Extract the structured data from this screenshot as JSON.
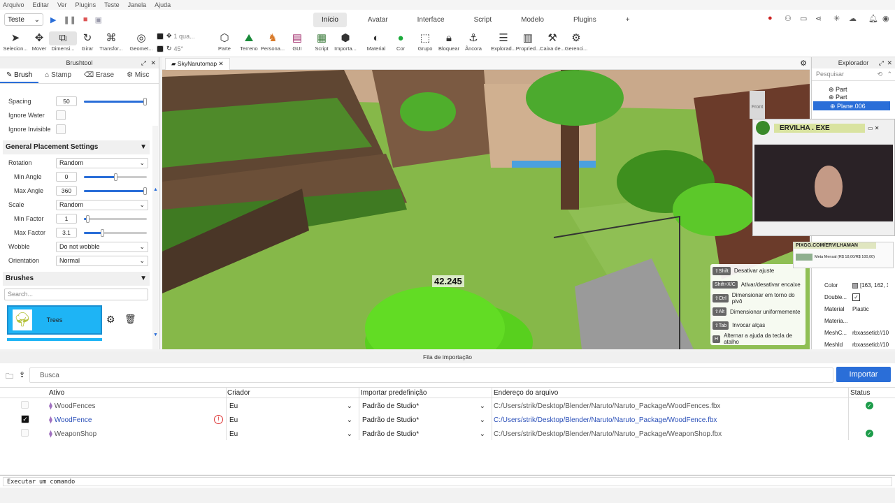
{
  "menu": [
    "Arquivo",
    "Editar",
    "Ver",
    "Plugins",
    "Teste",
    "Janela",
    "Ajuda"
  ],
  "place_select": "Teste",
  "ribbon_tabs": [
    "Início",
    "Avatar",
    "Interface",
    "Script",
    "Modelo",
    "Plugins"
  ],
  "tools": [
    "Selecion...",
    "Mover",
    "Dimensi...",
    "Girar",
    "Transfor...",
    "Geomet...",
    "Parte",
    "Terreno",
    "Persona...",
    "GUI",
    "Script",
    "Importa...",
    "Material",
    "Cor",
    "Grupo",
    "Bloquear",
    "Âncora",
    "Explorad...",
    "Propried...",
    "Caixa de...",
    "Gerenci..."
  ],
  "snap": {
    "move": "1 qua...",
    "rotate": "45°"
  },
  "brushtool": {
    "title": "Brushtool",
    "tabs": [
      "Brush",
      "Stamp",
      "Erase",
      "Misc"
    ],
    "spacing_label": "Spacing",
    "spacing_value": "50",
    "ignore_water": "Ignore Water",
    "ignore_invisible": "Ignore Invisible",
    "section_general": "General Placement Settings",
    "rotation_label": "Rotation",
    "rotation_value": "Random",
    "min_angle_label": "Min Angle",
    "min_angle_value": "0",
    "max_angle_label": "Max Angle",
    "max_angle_value": "360",
    "scale_label": "Scale",
    "scale_value": "Random",
    "min_factor_label": "Min Factor",
    "min_factor_value": "1",
    "max_factor_label": "Max Factor",
    "max_factor_value": "3.1",
    "wobble_label": "Wobble",
    "wobble_value": "Do not wobble",
    "orientation_label": "Orientation",
    "orientation_value": "Normal",
    "section_brushes": "Brushes",
    "search_placeholder": "Search...",
    "brush_name": "Trees",
    "sliders": {
      "spacing": 0.97,
      "min_angle": 0.5,
      "max_angle": 1.0,
      "min_factor": 0.05,
      "max_factor": 0.29
    }
  },
  "viewport": {
    "tab": "SkyNarutomap",
    "distance": "42.245",
    "view_cube": "Front"
  },
  "hud": [
    {
      "key": "⇧Shift",
      "text": "Desativar ajuste"
    },
    {
      "key": "Shift+X/C",
      "text": "Ativar/desativar encaixe"
    },
    {
      "key": "⇧Ctrl",
      "text": "Dimensionar em torno do pivô"
    },
    {
      "key": "⇧Alt",
      "text": "Dimensionar uniformemente"
    },
    {
      "key": "⇧Tab",
      "text": "Invocar alças"
    },
    {
      "key": "H",
      "text": "Alternar a ajuda da tecla de atalho"
    }
  ],
  "explorer": {
    "title": "Explorador",
    "search_placeholder": "Pesquisar",
    "items": [
      "Part",
      "Part",
      "Plane.006"
    ],
    "props": [
      {
        "name": "Color",
        "value": "[163, 162, 1"
      },
      {
        "name": "Double...",
        "value": "✓"
      },
      {
        "name": "Material",
        "value": "Plastic"
      },
      {
        "name": "Materia...",
        "value": ""
      },
      {
        "name": "MeshC...",
        "value": "rbxassetid://10"
      },
      {
        "name": "MeshId",
        "value": "rbxassetid://10"
      }
    ]
  },
  "webcam": {
    "title": "ERVILHA . EXE",
    "banner": "PIXGG.COM/ERVILHAMAN",
    "meta": "Meta Mensal (R$ 18,00/R$ 100,00)"
  },
  "import_queue": {
    "title": "Fila de importação",
    "search_placeholder": "Busca",
    "import_button": "Importar",
    "columns": [
      "Ativo",
      "Criador",
      "Importar predefinição",
      "Endereço do arquivo",
      "Status"
    ],
    "rows": [
      {
        "name": "WoodFences",
        "creator": "Eu",
        "preset": "Padrão de Studio*",
        "path": "C:/Users/strik/Desktop/Blender/Naruto/Naruto_Package/WoodFences.fbx",
        "checked": false,
        "status": "ok"
      },
      {
        "name": "WoodFence",
        "creator": "Eu",
        "preset": "Padrão de Studio*",
        "path": "C:/Users/strik/Desktop/Blender/Naruto/Naruto_Package/WoodFence.fbx",
        "checked": true,
        "status": "warning"
      },
      {
        "name": "WeaponShop",
        "creator": "Eu",
        "preset": "Padrão de Studio*",
        "path": "C:/Users/strik/Desktop/Blender/Naruto/Naruto_Package/WeaponShop.fbx",
        "checked": false,
        "status": "ok"
      }
    ]
  },
  "command_placeholder": "Executar um comando",
  "colors": {
    "accent": "#2a6ed8",
    "ok": "#1d9c4a",
    "warn": "#d33",
    "brush_tile": "#1eb4f5"
  }
}
